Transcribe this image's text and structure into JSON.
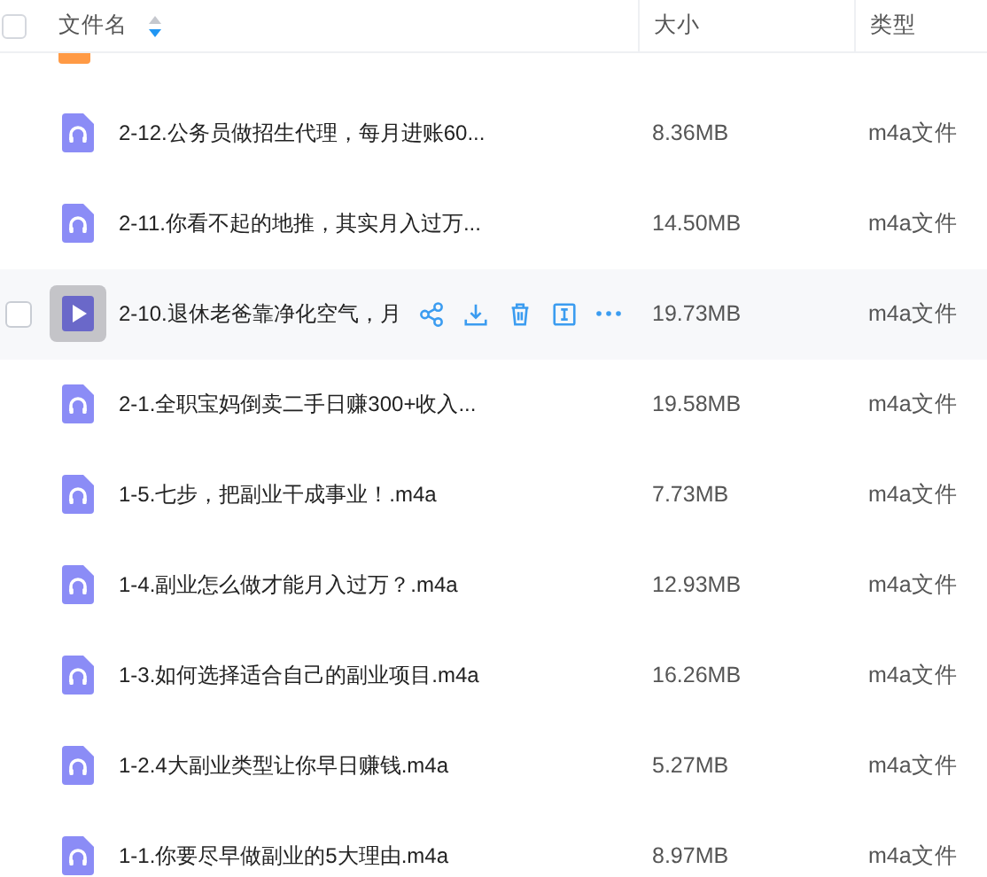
{
  "header": {
    "select_all_checked": false,
    "columns": [
      {
        "label": "文件名",
        "sortable": true
      },
      {
        "label": "大小",
        "sortable": false
      },
      {
        "label": "类型",
        "sortable": false
      }
    ]
  },
  "rows": [
    {
      "name": "2-12.公务员做招生代理，每月进账60...",
      "size": "8.36MB",
      "type": "m4a文件",
      "hovered": false
    },
    {
      "name": "2-11.你看不起的地推，其实月入过万...",
      "size": "14.50MB",
      "type": "m4a文件",
      "hovered": false
    },
    {
      "name": "2-10.退休老爸靠净化空气，月",
      "size": "19.73MB",
      "type": "m4a文件",
      "hovered": true
    },
    {
      "name": "2-1.全职宝妈倒卖二手日赚300+收入...",
      "size": "19.58MB",
      "type": "m4a文件",
      "hovered": false
    },
    {
      "name": "1-5.七步，把副业干成事业！.m4a",
      "size": "7.73MB",
      "type": "m4a文件",
      "hovered": false
    },
    {
      "name": "1-4.副业怎么做才能月入过万？.m4a",
      "size": "12.93MB",
      "type": "m4a文件",
      "hovered": false
    },
    {
      "name": "1-3.如何选择适合自己的副业项目.m4a",
      "size": "16.26MB",
      "type": "m4a文件",
      "hovered": false
    },
    {
      "name": "1-2.4大副业类型让你早日赚钱.m4a",
      "size": "5.27MB",
      "type": "m4a文件",
      "hovered": false
    },
    {
      "name": "1-1.你要尽早做副业的5大理由.m4a",
      "size": "8.97MB",
      "type": "m4a文件",
      "hovered": false
    }
  ]
}
